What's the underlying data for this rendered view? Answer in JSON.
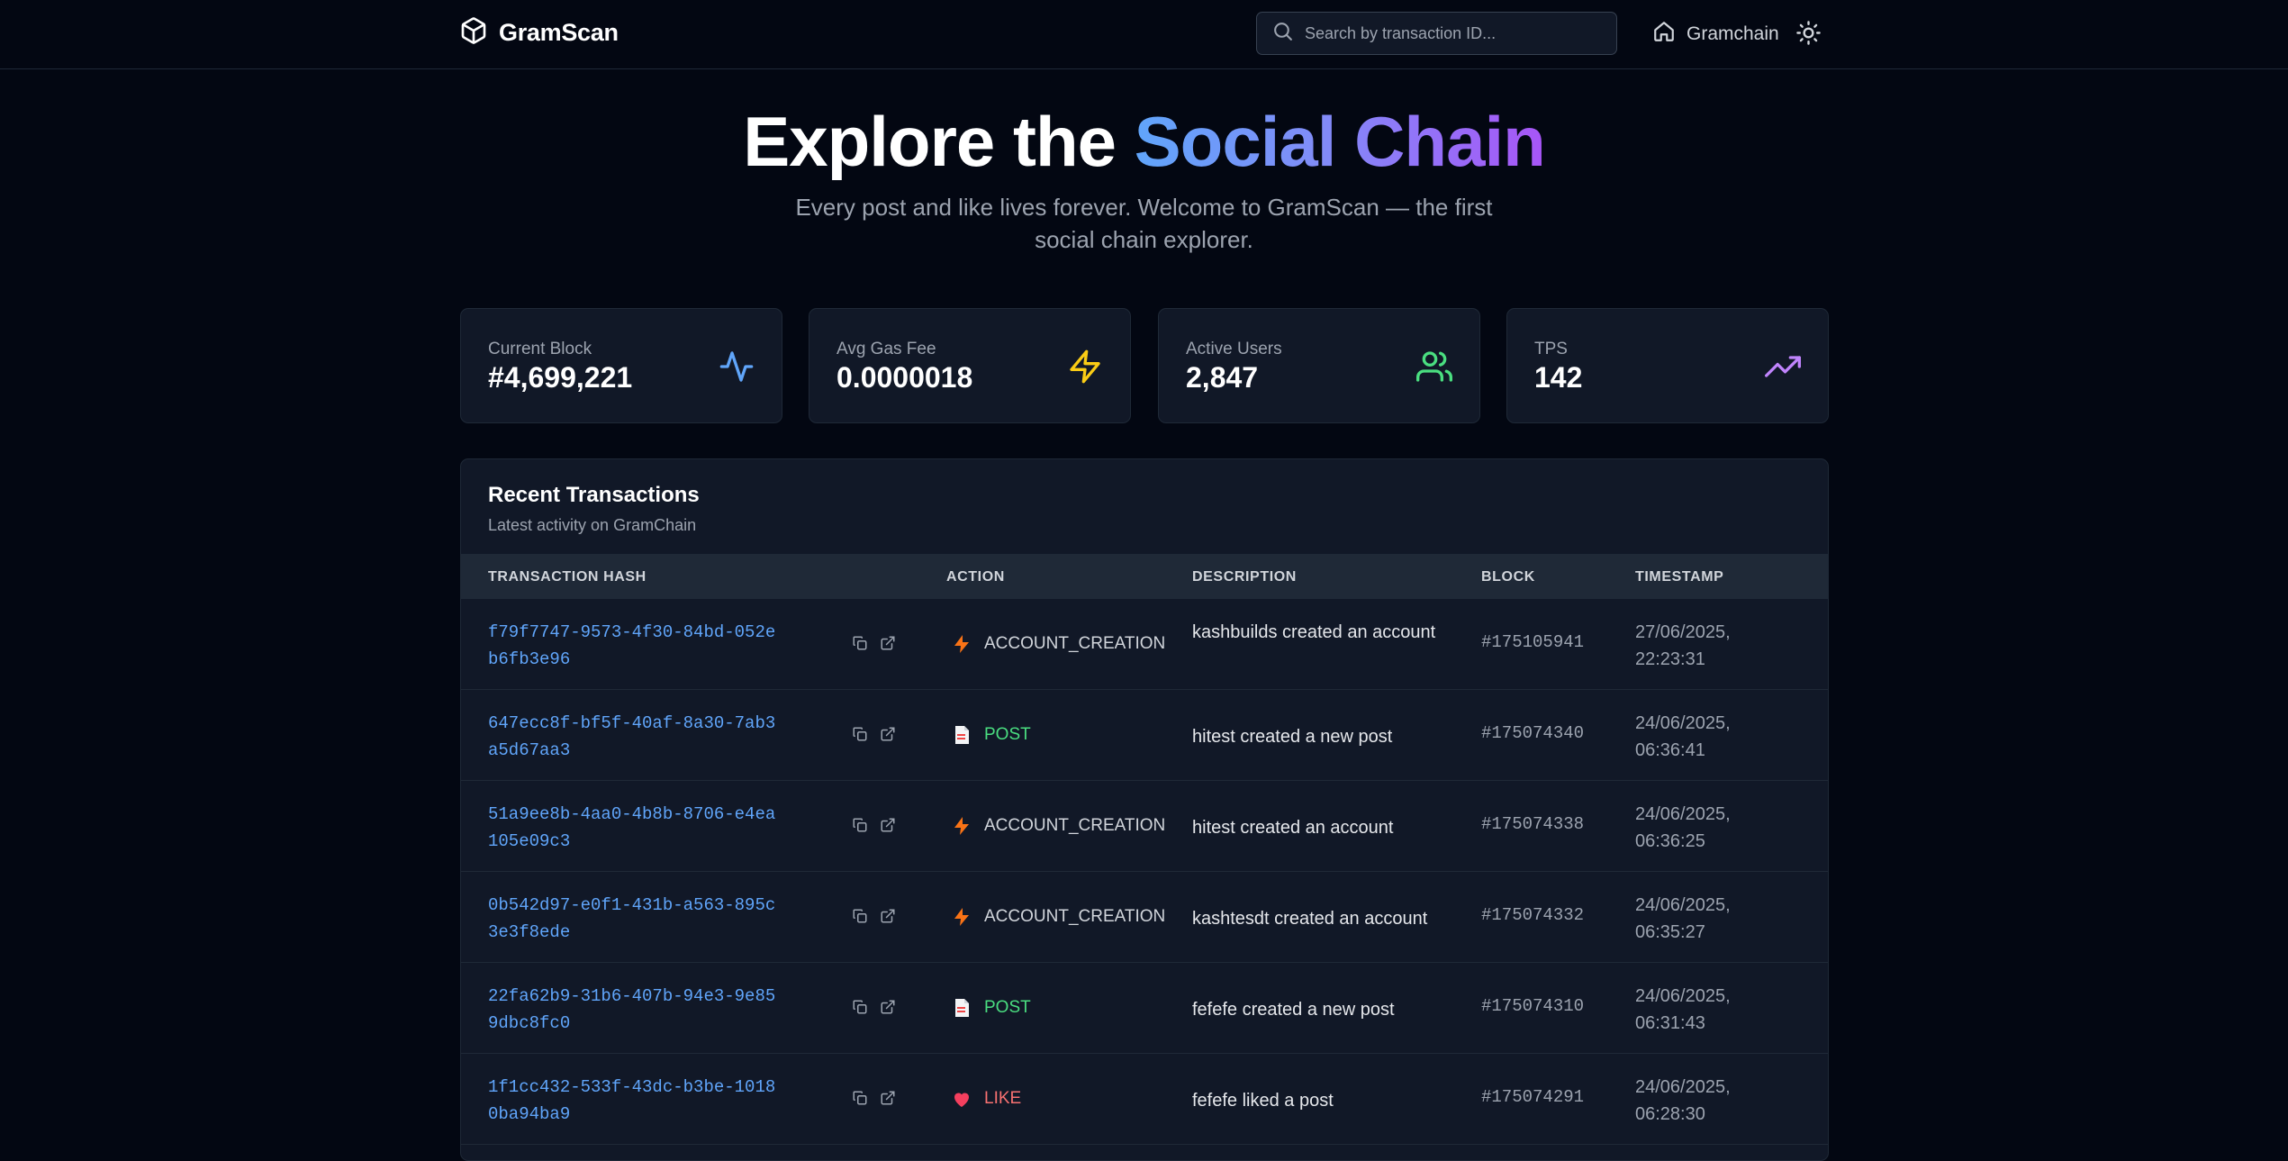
{
  "header": {
    "logo_text": "GramScan",
    "search_placeholder": "Search by transaction ID...",
    "nav_link": "Gramchain"
  },
  "hero": {
    "title_prefix": "Explore the ",
    "title_highlight": "Social Chain",
    "subtitle": "Every post and like lives forever. Welcome to GramScan — the first social chain explorer."
  },
  "stats": [
    {
      "label": "Current Block",
      "value": "#4,699,221",
      "icon": "activity-icon",
      "color": "#60a5fa"
    },
    {
      "label": "Avg Gas Fee",
      "value": "0.0000018",
      "icon": "lightning-icon",
      "color": "#facc15"
    },
    {
      "label": "Active Users",
      "value": "2,847",
      "icon": "users-icon",
      "color": "#4ade80"
    },
    {
      "label": "TPS",
      "value": "142",
      "icon": "trending-up-icon",
      "color": "#c084fc"
    }
  ],
  "transactions": {
    "title": "Recent Transactions",
    "subtitle": "Latest activity on GramChain",
    "columns": [
      "TRANSACTION HASH",
      "ACTION",
      "DESCRIPTION",
      "BLOCK",
      "TIMESTAMP"
    ],
    "rows": [
      {
        "hash": "f79f7747-9573-4f30-84bd-052eb6fb3e96",
        "action": "ACCOUNT_CREATION",
        "action_icon": "lightning-icon",
        "description": "kashbuilds created an account",
        "block": "#175105941",
        "timestamp": "27/06/2025, 22:23:31"
      },
      {
        "hash": "647ecc8f-bf5f-40af-8a30-7ab3a5d67aa3",
        "action": "POST",
        "action_icon": "document-icon",
        "description": "hitest created a new post",
        "block": "#175074340",
        "timestamp": "24/06/2025, 06:36:41"
      },
      {
        "hash": "51a9ee8b-4aa0-4b8b-8706-e4ea105e09c3",
        "action": "ACCOUNT_CREATION",
        "action_icon": "lightning-icon",
        "description": "hitest created an account",
        "block": "#175074338",
        "timestamp": "24/06/2025, 06:36:25"
      },
      {
        "hash": "0b542d97-e0f1-431b-a563-895c3e3f8ede",
        "action": "ACCOUNT_CREATION",
        "action_icon": "lightning-icon",
        "description": "kashtesdt created an account",
        "block": "#175074332",
        "timestamp": "24/06/2025, 06:35:27"
      },
      {
        "hash": "22fa62b9-31b6-407b-94e3-9e859dbc8fc0",
        "action": "POST",
        "action_icon": "document-icon",
        "description": "fefefe created a new post",
        "block": "#175074310",
        "timestamp": "24/06/2025, 06:31:43"
      },
      {
        "hash": "1f1cc432-533f-43dc-b3be-10180ba94ba9",
        "action": "LIKE",
        "action_icon": "heart-icon",
        "description": "fefefe liked a post",
        "block": "#175074291",
        "timestamp": "24/06/2025, 06:28:30"
      }
    ]
  },
  "colors": {
    "background": "#030712",
    "card": "#111827",
    "hash_link": "#60a5fa",
    "account_creation": "#d1d5db",
    "post": "#4ade80",
    "like": "#f87171"
  }
}
